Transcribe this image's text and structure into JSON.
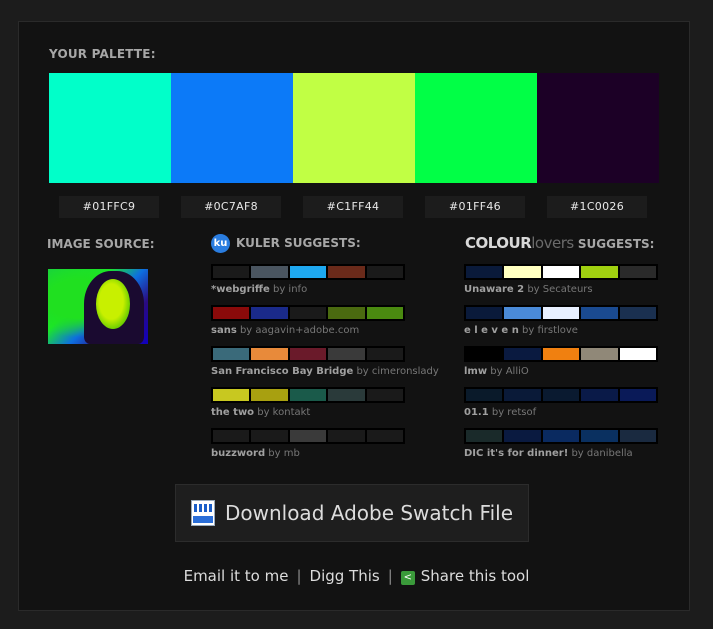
{
  "palette": {
    "title": "YOUR PALETTE:",
    "colors": [
      "#01FFC9",
      "#0C7AF8",
      "#C1FF44",
      "#01FF46",
      "#1C0026"
    ],
    "hex_labels": [
      "#01FFC9",
      "#0C7AF8",
      "#C1FF44",
      "#01FF46",
      "#1C0026"
    ]
  },
  "image_source": {
    "title": "IMAGE SOURCE:"
  },
  "kuler": {
    "logo_text": "ku",
    "title": "KULER SUGGESTS:",
    "items": [
      {
        "name": "*webgriffe",
        "by": "by info",
        "colors": [
          "#1a1a1a",
          "#4a5560",
          "#1ea8f0",
          "#6a2a1a",
          "#1a1a1a"
        ]
      },
      {
        "name": "sans",
        "by": "by aagavin+adobe.com",
        "colors": [
          "#8a0a0a",
          "#1a2a8a",
          "#1a1a1a",
          "#4a6a10",
          "#4a8a10"
        ]
      },
      {
        "name": "San Francisco Bay Bridge",
        "by": "by cimeronslady",
        "colors": [
          "#3a6a7a",
          "#e88a3a",
          "#6a1a2a",
          "#3a3a3a",
          "#1a1a1a"
        ]
      },
      {
        "name": "the two",
        "by": "by kontakt",
        "colors": [
          "#c8c820",
          "#a8a010",
          "#1a5a4a",
          "#2a3a3a",
          "#1a1a1a"
        ]
      },
      {
        "name": "buzzword",
        "by": "by mb",
        "colors": [
          "#1a1a1a",
          "#1a1a1a",
          "#3a3a3a",
          "#1a1a1a",
          "#1a1a1a"
        ]
      }
    ]
  },
  "colourlovers": {
    "logo_a": "COLOUR",
    "logo_b": "lovers",
    "title": "SUGGESTS:",
    "items": [
      {
        "name": "Unaware 2",
        "by": "by Secateurs",
        "colors": [
          "#0a1a3a",
          "#ffffc0",
          "#ffffff",
          "#a0d010",
          "#2a2a2a"
        ]
      },
      {
        "name": "e l e v e n",
        "by": "by firstlove",
        "colors": [
          "#0a1a3a",
          "#4a8ad8",
          "#e8f0ff",
          "#1a4a90",
          "#1a3050"
        ]
      },
      {
        "name": "lmw",
        "by": "by AlliO",
        "colors": [
          "#000000",
          "#0a1a40",
          "#f08010",
          "#908878",
          "#ffffff"
        ]
      },
      {
        "name": "01.1",
        "by": "by retsof",
        "colors": [
          "#0a1a2a",
          "#0a1a38",
          "#0a1a30",
          "#0a1a48",
          "#0a1a58"
        ]
      },
      {
        "name": "DIC it's for dinner!",
        "by": "by danibella",
        "colors": [
          "#1a2a2a",
          "#0a1a40",
          "#0a2a60",
          "#0a3060",
          "#1a2a40"
        ]
      }
    ]
  },
  "download": {
    "label": "Download Adobe Swatch File",
    "icon": "swatch-file-icon"
  },
  "links": {
    "email": "Email it to me",
    "sep": "|",
    "digg": "Digg This",
    "share": "Share this tool"
  }
}
